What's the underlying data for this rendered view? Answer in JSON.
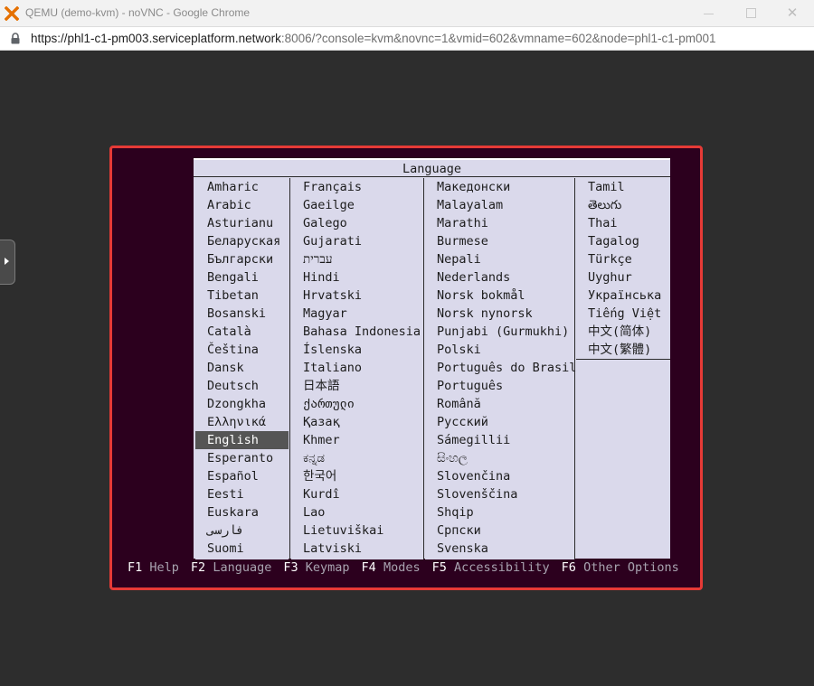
{
  "window": {
    "title": "QEMU (demo-kvm) - noVNC - Google Chrome",
    "close_glyph": "✕"
  },
  "address_bar": {
    "url_host": "https://phl1-c1-pm003.serviceplatform.network",
    "url_rest": ":8006/?console=kvm&novnc=1&vmid=602&vmname=602&node=phl1-c1-pm001"
  },
  "installer": {
    "dialog_title": "Language",
    "selected_language": "English",
    "columns": [
      [
        "Amharic",
        "Arabic",
        "Asturianu",
        "Беларуская",
        "Български",
        "Bengali",
        "Tibetan",
        "Bosanski",
        "Català",
        "Čeština",
        "Dansk",
        "Deutsch",
        "Dzongkha",
        "Ελληνικά",
        "English",
        "Esperanto",
        "Español",
        "Eesti",
        "Euskara",
        "فارسی",
        "Suomi"
      ],
      [
        "Français",
        "Gaeilge",
        "Galego",
        "Gujarati",
        "עברית",
        "Hindi",
        "Hrvatski",
        "Magyar",
        "Bahasa Indonesia",
        "Íslenska",
        "Italiano",
        "日本語",
        "ქართული",
        "Қазақ",
        "Khmer",
        "ಕನ್ನಡ",
        "한국어",
        "Kurdî",
        "Lao",
        "Lietuviškai",
        "Latviski"
      ],
      [
        "Македонски",
        "Malayalam",
        "Marathi",
        "Burmese",
        "Nepali",
        "Nederlands",
        "Norsk bokmål",
        "Norsk nynorsk",
        "Punjabi (Gurmukhi)",
        "Polski",
        "Português do Brasil",
        "Português",
        "Română",
        "Русский",
        "Sámegillii",
        "සිංහල",
        "Slovenčina",
        "Slovenščina",
        "Shqip",
        "Српски",
        "Svenska"
      ],
      [
        "Tamil",
        "తెలుగు",
        "Thai",
        "Tagalog",
        "Türkçe",
        "Uyghur",
        "Українська",
        "Tiếng Việt",
        "中文(简体)",
        "中文(繁體)"
      ]
    ],
    "function_keys": [
      {
        "key": "F1",
        "label": "Help"
      },
      {
        "key": "F2",
        "label": "Language"
      },
      {
        "key": "F3",
        "label": "Keymap"
      },
      {
        "key": "F4",
        "label": "Modes"
      },
      {
        "key": "F5",
        "label": "Accessibility"
      },
      {
        "key": "F6",
        "label": "Other Options"
      }
    ]
  },
  "icons": {
    "app": "proxmox-x-icon",
    "lock": "lock-icon",
    "handle": "expand-arrow-icon"
  },
  "colors": {
    "vnc_background": "#2c001e",
    "dialog_background": "#dad9eb",
    "selection": "#555555",
    "frame_highlight": "#e63a36",
    "app_icon_orange": "#e57000"
  }
}
